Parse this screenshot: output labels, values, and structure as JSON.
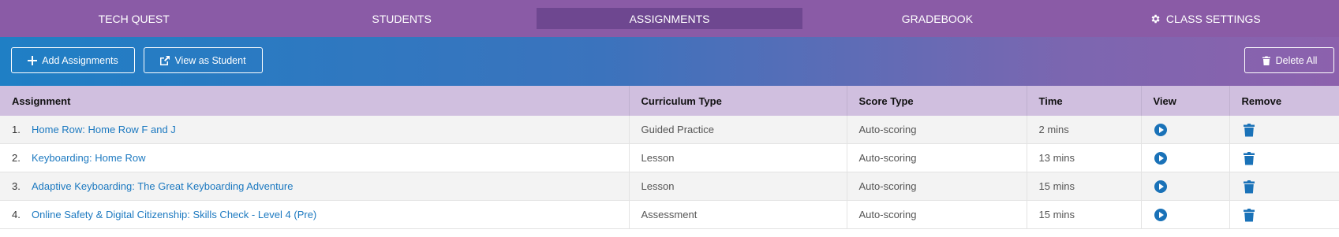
{
  "nav": {
    "items": [
      {
        "label": "TECH QUEST",
        "active": false
      },
      {
        "label": "STUDENTS",
        "active": false
      },
      {
        "label": "ASSIGNMENTS",
        "active": true
      },
      {
        "label": "GRADEBOOK",
        "active": false
      },
      {
        "label": "CLASS SETTINGS",
        "active": false,
        "icon": "gear-icon"
      }
    ]
  },
  "toolbar": {
    "add_label": "Add Assignments",
    "view_label": "View as Student",
    "delete_label": "Delete All"
  },
  "table": {
    "headers": [
      "Assignment",
      "Curriculum Type",
      "Score Type",
      "Time",
      "View",
      "Remove"
    ],
    "rows": [
      {
        "num": "1.",
        "assignment": "Home Row: Home Row F and J",
        "curriculum": "Guided Practice",
        "score": "Auto-scoring",
        "time": "2 mins"
      },
      {
        "num": "2.",
        "assignment": "Keyboarding: Home Row",
        "curriculum": "Lesson",
        "score": "Auto-scoring",
        "time": "13 mins"
      },
      {
        "num": "3.",
        "assignment": "Adaptive Keyboarding: The Great Keyboarding Adventure",
        "curriculum": "Lesson",
        "score": "Auto-scoring",
        "time": "15 mins"
      },
      {
        "num": "4.",
        "assignment": "Online Safety & Digital Citizenship: Skills Check - Level 4 (Pre)",
        "curriculum": "Assessment",
        "score": "Auto-scoring",
        "time": "15 mins"
      }
    ]
  },
  "colors": {
    "nav_bg": "#8a5ba6",
    "nav_active": "#6e4790",
    "header_row": "#d0bfdf",
    "link": "#1c79c0"
  }
}
